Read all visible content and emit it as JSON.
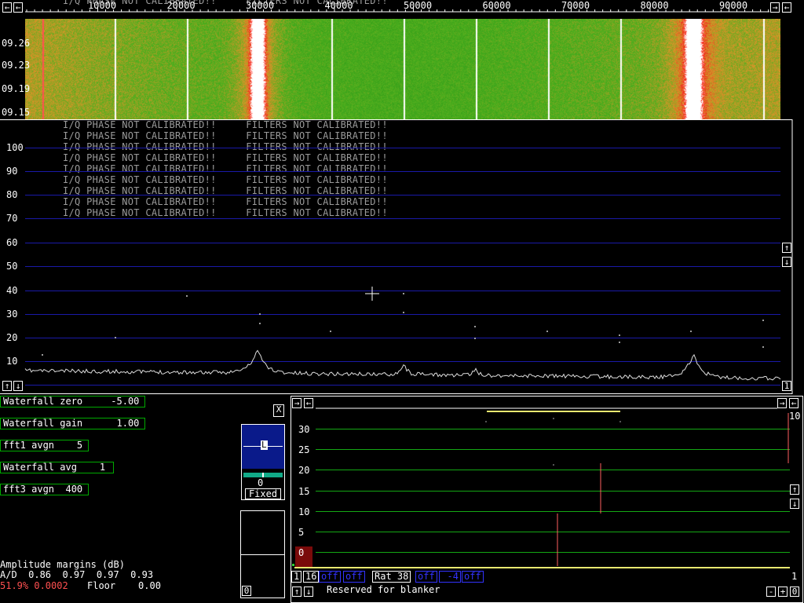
{
  "frequency_axis": {
    "labels": [
      "10000",
      "20000",
      "30000",
      "40000",
      "50000",
      "60000",
      "70000",
      "80000",
      "90000"
    ],
    "top_overlay_text": "I/Q PHASE NOT CALIBRATED!!     FILTERS NOT CALIBRATED!!"
  },
  "waterfall": {
    "time_labels": [
      "09.26",
      "09.23",
      "09.19",
      "09.15"
    ]
  },
  "spectrum": {
    "y_labels": [
      "100",
      "90",
      "80",
      "70",
      "60",
      "50",
      "40",
      "30",
      "20",
      "10"
    ],
    "warning_lines": [
      "I/Q PHASE NOT CALIBRATED!!     FILTERS NOT CALIBRATED!!",
      "I/Q PHASE NOT CALIBRATED!!     FILTERS NOT CALIBRATED!!",
      "I/Q PHASE NOT CALIBRATED!!     FILTERS NOT CALIBRATED!!",
      "I/Q PHASE NOT CALIBRATED!!     FILTERS NOT CALIBRATED!!",
      "I/Q PHASE NOT CALIBRATED!!     FILTERS NOT CALIBRATED!!",
      "I/Q PHASE NOT CALIBRATED!!     FILTERS NOT CALIBRATED!!",
      "I/Q PHASE NOT CALIBRATED!!     FILTERS NOT CALIBRATED!!",
      "I/Q PHASE NOT CALIBRATED!!     FILTERS NOT CALIBRATED!!",
      "I/Q PHASE NOT CALIBRATED!!     FILTERS NOT CALIBRATED!!"
    ],
    "right_button_label": "1"
  },
  "buttons": {
    "left_arrow": "←",
    "right_arrow": "→",
    "up_arrow": "↑",
    "down_arrow": "↓",
    "close": "X",
    "minus": "-",
    "plus": "+",
    "zero": "0"
  },
  "params": {
    "waterfall_zero": "Waterfall zero     -5.00",
    "waterfall_gain": "Waterfall gain      1.00",
    "fft1_avgn": "fft1 avgn    5",
    "waterfall_avg": "Waterfall avg    1",
    "fft3_avgn": "fft3 avgn  400"
  },
  "meter": {
    "marker": "L",
    "value": "0",
    "mode": "Fixed",
    "lower_label": "0"
  },
  "amplitude": {
    "title": "Amplitude margins (dB)",
    "ad_line": "A/D  0.86  0.97  0.97  0.93",
    "status_red": "51.9% 0.0002",
    "floor": "Floor    0.00"
  },
  "baseband": {
    "y_labels": [
      "30",
      "25",
      "20",
      "15",
      "10",
      "5",
      "0"
    ],
    "top_right_label": "10",
    "bottom_right_label": "1",
    "controls": {
      "b1": "1",
      "b16": "16",
      "off1": "off",
      "off2": "off",
      "rat": "Rat 38",
      "off3": "off",
      "minus4": "-4",
      "off4": "off"
    },
    "status": "Reserved for blanker"
  },
  "colors": {
    "grid_blue": "#1a1aa8",
    "grid_green": "#14a814",
    "param_border": "#00aa00",
    "status_red": "#ff5050"
  }
}
